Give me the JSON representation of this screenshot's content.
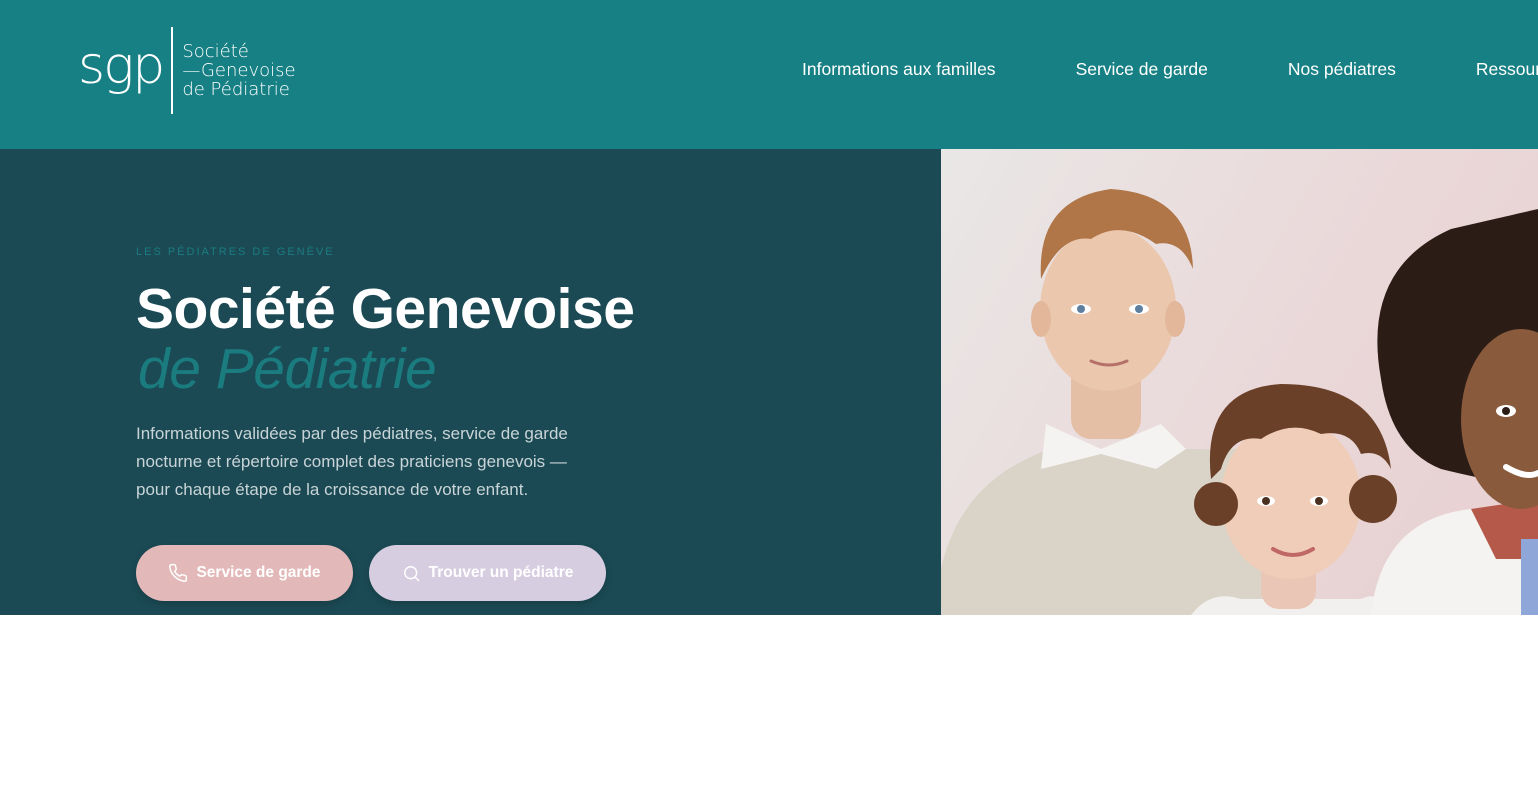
{
  "header": {
    "logo": {
      "mark": "sgp",
      "line1": "Société",
      "line2": "—Genevoise",
      "line3": "de Pédiatrie"
    },
    "nav": [
      "Informations aux familles",
      "Service de garde",
      "Nos pédiatres",
      "Ressources"
    ]
  },
  "hero": {
    "eyebrow": "LES PÉDIATRES DE GENÈVE",
    "title_line1": "Société Genevoise",
    "title_line2": "de Pédiatrie",
    "description_lines": [
      "Informations validées par des pédiatres, service de garde",
      "nocturne et répertoire complet des praticiens genevois —",
      "pour chaque étape de la croissance de votre enfant."
    ],
    "buttons": {
      "garde": {
        "label": "Service de garde",
        "icon": "phone-icon"
      },
      "find": {
        "label": "Trouver un pédiatre",
        "icon": "search-icon"
      }
    }
  },
  "colors": {
    "header_bg": "#178084",
    "hero_bg": "#1b4a54",
    "accent_teal": "#1b7c80",
    "button_pink": "#e3b8b8",
    "button_lavender": "#d6cde1"
  }
}
